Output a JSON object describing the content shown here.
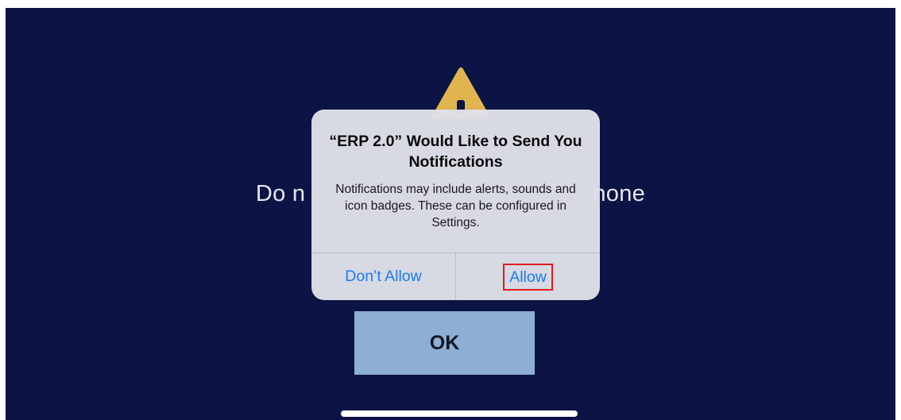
{
  "colors": {
    "background": "#0c1445",
    "ok_button_bg": "#8eaed3",
    "accent": "#1a7cf5",
    "warning": "#e0b54f"
  },
  "background_screen": {
    "warning_icon": "warning-triangle-icon",
    "message_left": "Do n",
    "message_right": "none",
    "ok_label": "OK"
  },
  "alert": {
    "title": "“ERP 2.0” Would Like to Send You Notifications",
    "message": "Notifications may include alerts, sounds and icon badges. These can be configured in Settings.",
    "dont_allow_label": "Don’t Allow",
    "allow_label": "Allow"
  }
}
